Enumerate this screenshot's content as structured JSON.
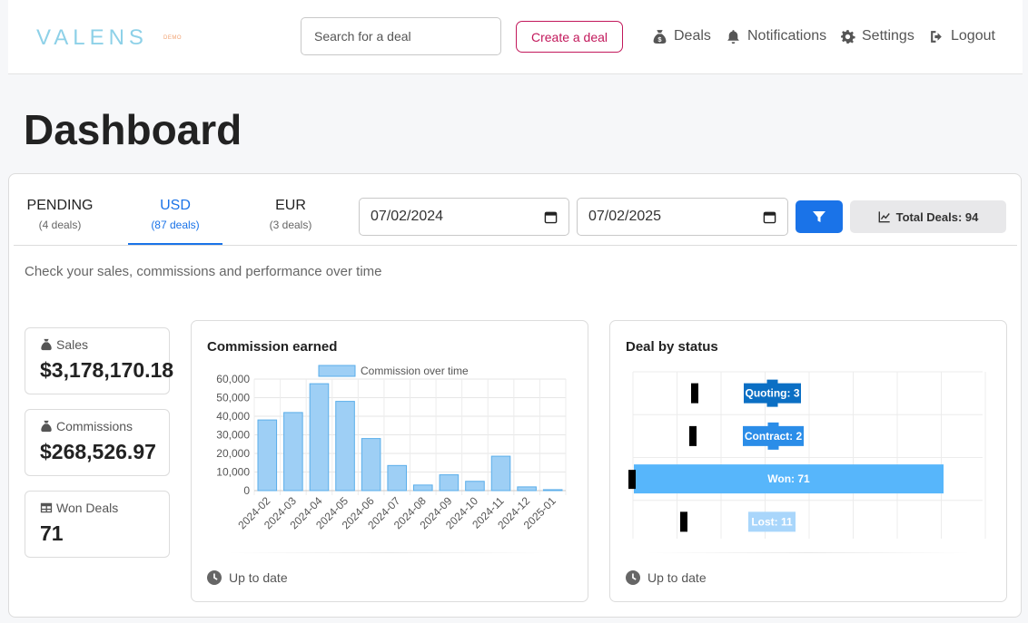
{
  "header": {
    "logo": "VALENS",
    "logo_badge": "DEMO",
    "search_placeholder": "Search for a deal",
    "create_label": "Create a deal",
    "nav": {
      "deals": "Deals",
      "notifications": "Notifications",
      "settings": "Settings",
      "logout": "Logout"
    }
  },
  "page_title": "Dashboard",
  "tabs": [
    {
      "label": "PENDING",
      "sub": "(4 deals)",
      "active": false
    },
    {
      "label": "USD",
      "sub": "(87 deals)",
      "active": true
    },
    {
      "label": "EUR",
      "sub": "(3 deals)",
      "active": false
    }
  ],
  "filters": {
    "date_from": "07/02/2024",
    "date_to": "07/02/2025",
    "total_label": "Total Deals: 94"
  },
  "subtitle": "Check your sales, commissions and performance over time",
  "stats": {
    "sales": {
      "label": "Sales",
      "value": "$3,178,170.18"
    },
    "commissions": {
      "label": "Commissions",
      "value": "$268,526.97"
    },
    "won": {
      "label": "Won Deals",
      "value": "71"
    }
  },
  "commission_chart": {
    "title": "Commission earned",
    "footer": "Up to date"
  },
  "status_chart": {
    "title": "Deal by status",
    "footer": "Up to date"
  },
  "chart_data": [
    {
      "type": "bar",
      "title": "Commission earned",
      "categories": [
        "2024-02",
        "2024-03",
        "2024-04",
        "2024-05",
        "2024-06",
        "2024-07",
        "2024-08",
        "2024-09",
        "2024-10",
        "2024-11",
        "2024-12",
        "2025-01"
      ],
      "series": [
        {
          "name": "Commission over time",
          "values": [
            38000,
            42000,
            57500,
            48000,
            28000,
            13500,
            3000,
            8500,
            5000,
            18500,
            2000,
            500
          ]
        }
      ],
      "ylim": [
        0,
        60000
      ],
      "yticks": [
        0,
        10000,
        20000,
        30000,
        40000,
        50000,
        60000
      ],
      "ytick_labels": [
        "0",
        "10,000",
        "20,000",
        "30,000",
        "40,000",
        "50,000",
        "60,000"
      ],
      "legend": "top",
      "grid": true,
      "color": "#9ecff5",
      "edge_color": "#5aaeea"
    },
    {
      "type": "bar",
      "orientation": "horizontal",
      "title": "Deal by status",
      "categories": [
        "Quoting",
        "Contract",
        "Won",
        "Lost"
      ],
      "values": [
        3,
        2,
        71,
        11
      ],
      "labels": [
        "Quoting: 3",
        "Contract: 2",
        "Won: 71",
        "Lost: 11"
      ],
      "colors": [
        "#0b6fc4",
        "#2b8de8",
        "#57b6fb",
        "#a9d6fb"
      ],
      "grid": true
    }
  ]
}
